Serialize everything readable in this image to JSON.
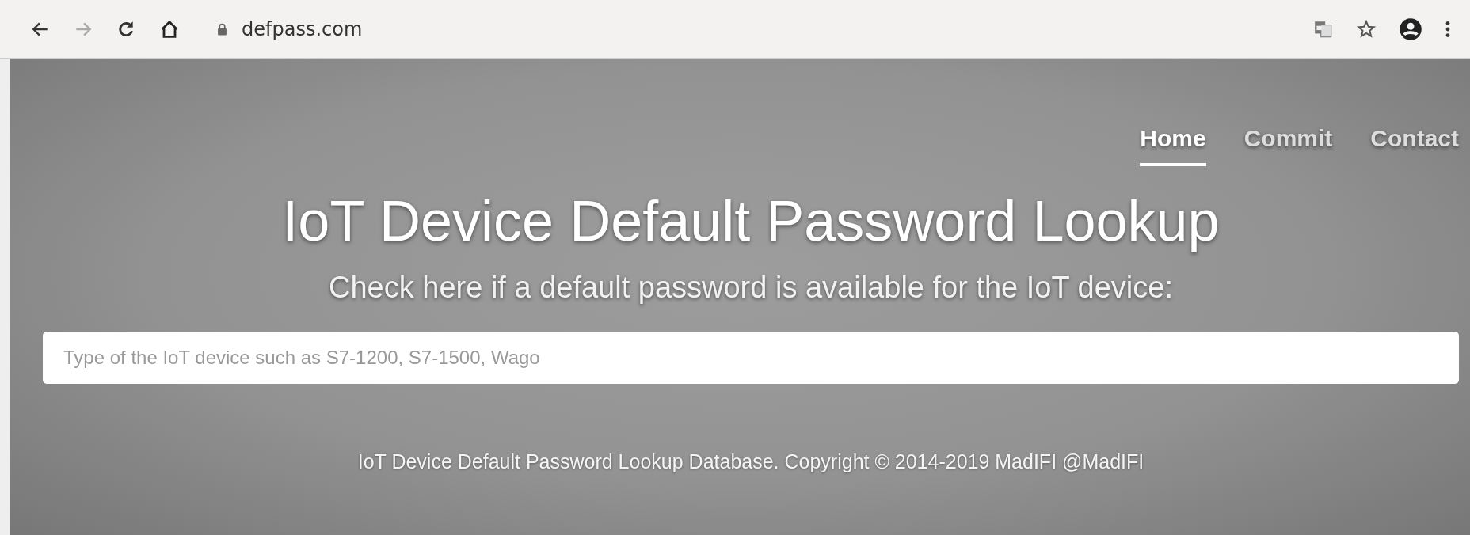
{
  "browser": {
    "url": "defpass.com"
  },
  "nav": [
    {
      "label": "Home",
      "selected": true
    },
    {
      "label": "Commit",
      "selected": false
    },
    {
      "label": "Contact",
      "selected": false
    }
  ],
  "hero": {
    "title": "IoT Device Default Password Lookup",
    "subtitle": "Check here if a default password is available for the IoT device:"
  },
  "search": {
    "placeholder": "Type of the IoT device such as S7-1200, S7-1500, Wago"
  },
  "footer": "IoT Device Default Password Lookup Database. Copyright © 2014-2019 MadIFI @MadIFI"
}
